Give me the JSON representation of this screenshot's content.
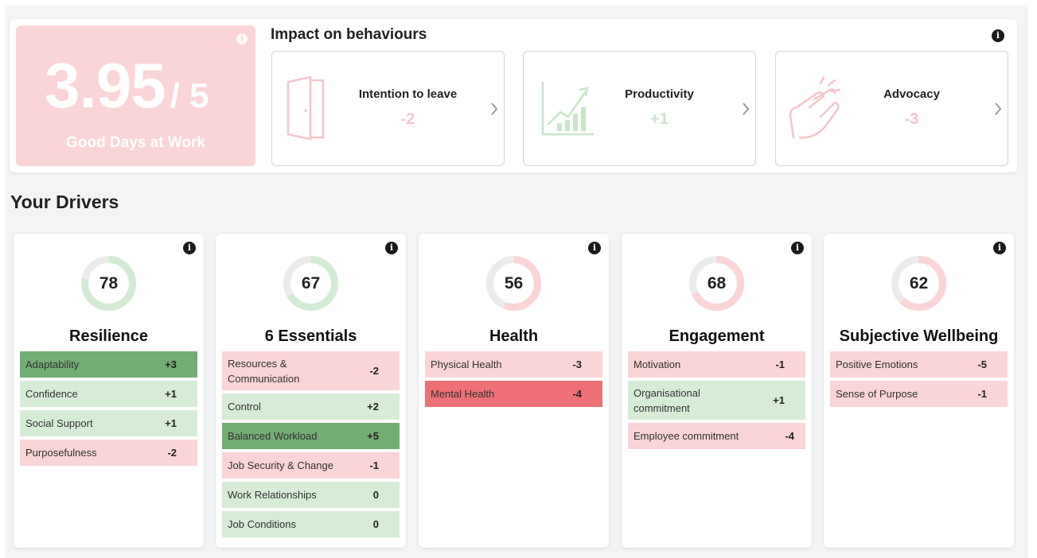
{
  "score": {
    "value": "3.95",
    "suffix": "/ 5",
    "label": "Good Days at Work",
    "color": "#fad4d6"
  },
  "impact": {
    "title": "Impact on behaviours",
    "items": [
      {
        "label": "Intention to leave",
        "value": "-2",
        "icon": "door-icon",
        "tone": "negative"
      },
      {
        "label": "Productivity",
        "value": "+1",
        "icon": "growth-chart-icon",
        "tone": "positive"
      },
      {
        "label": "Advocacy",
        "value": "-3",
        "icon": "clapping-hands-icon",
        "tone": "negative"
      }
    ]
  },
  "drivers_title": "Your Drivers",
  "drivers": [
    {
      "title": "Resilience",
      "score": "78",
      "items": [
        {
          "label": "Adaptability",
          "value": "+3",
          "tone": "dark-green"
        },
        {
          "label": "Confidence",
          "value": "+1",
          "tone": "light-green"
        },
        {
          "label": "Social Support",
          "value": "+1",
          "tone": "light-green"
        },
        {
          "label": "Purposefulness",
          "value": "-2",
          "tone": "light-red"
        }
      ]
    },
    {
      "title": "6 Essentials",
      "score": "67",
      "items": [
        {
          "label": "Resources & Communication",
          "value": "-2",
          "tone": "light-red"
        },
        {
          "label": "Control",
          "value": "+2",
          "tone": "light-green"
        },
        {
          "label": "Balanced Workload",
          "value": "+5",
          "tone": "dark-green"
        },
        {
          "label": "Job Security & Change",
          "value": "-1",
          "tone": "light-red"
        },
        {
          "label": "Work Relationships",
          "value": "0",
          "tone": "light-green"
        },
        {
          "label": "Job Conditions",
          "value": "0",
          "tone": "light-green"
        }
      ]
    },
    {
      "title": "Health",
      "score": "56",
      "items": [
        {
          "label": "Physical Health",
          "value": "-3",
          "tone": "light-red"
        },
        {
          "label": "Mental Health",
          "value": "-4",
          "tone": "dark-red"
        }
      ]
    },
    {
      "title": "Engagement",
      "score": "68",
      "items": [
        {
          "label": "Motivation",
          "value": "-1",
          "tone": "light-red"
        },
        {
          "label": "Organisational commitment",
          "value": "+1",
          "tone": "light-green"
        },
        {
          "label": "Employee commitment",
          "value": "-4",
          "tone": "light-red"
        }
      ]
    },
    {
      "title": "Subjective Wellbeing",
      "score": "62",
      "items": [
        {
          "label": "Positive Emotions",
          "value": "-5",
          "tone": "light-red"
        },
        {
          "label": "Sense of Purpose",
          "value": "-1",
          "tone": "light-red"
        }
      ]
    }
  ],
  "colors": {
    "dark_green": "#72ad72",
    "light_green": "#d6ecd7",
    "light_red": "#fad4d6",
    "dark_red": "#ed7074",
    "donut_green": "#d3ebd4",
    "donut_red": "#fad4d6",
    "donut_track": "#ececec"
  }
}
